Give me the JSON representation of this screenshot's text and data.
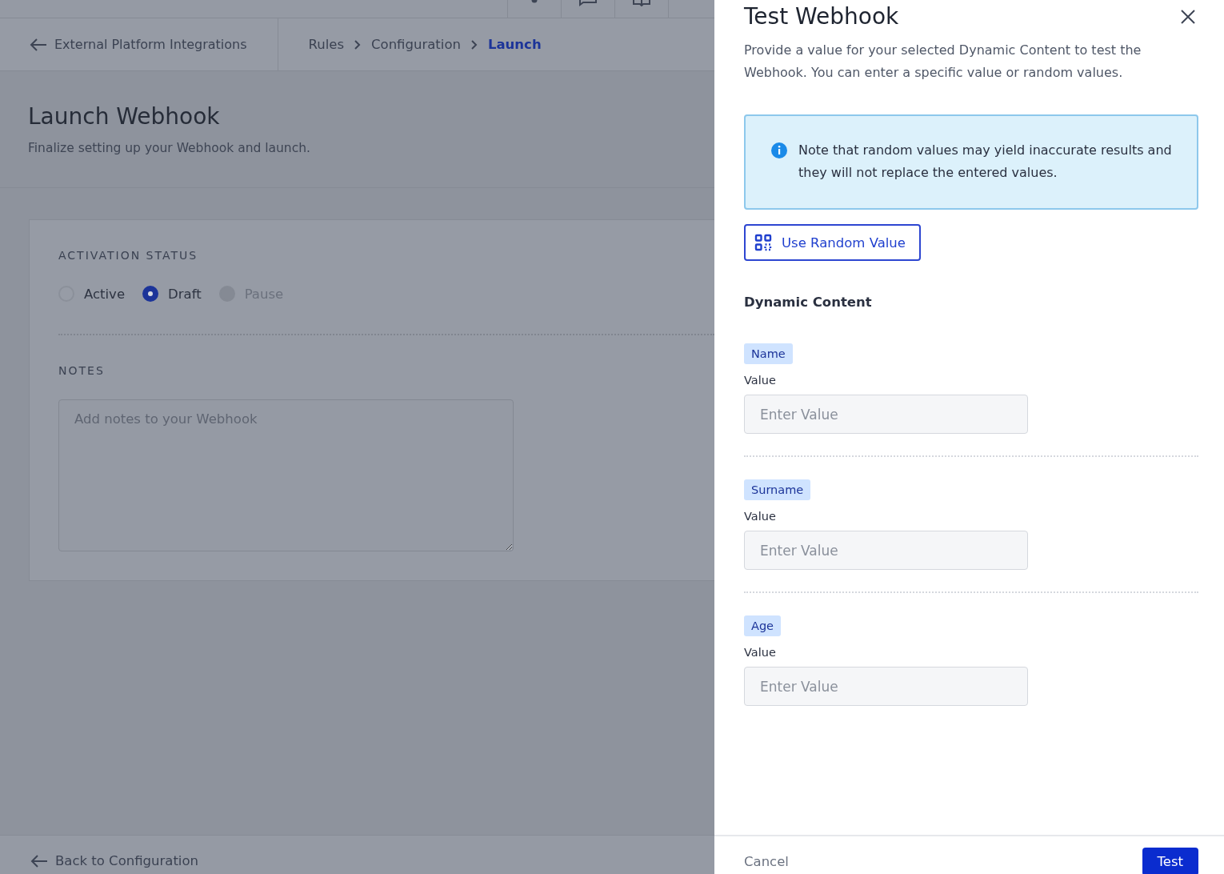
{
  "top_bar": {
    "icons": [
      {
        "kind": "dot"
      },
      {
        "kind": "chat"
      },
      {
        "kind": "book"
      }
    ]
  },
  "breadcrumb_bar": {
    "back_link": "External Platform Integrations",
    "crumbs": [
      {
        "label": "Rules",
        "selected": false
      },
      {
        "label": "Configuration",
        "selected": false
      },
      {
        "label": "Launch",
        "selected": true
      }
    ]
  },
  "page": {
    "title": "Launch Webhook",
    "subtitle": "Finalize setting up your Webhook and launch."
  },
  "activation_status": {
    "heading": "ACTIVATION STATUS",
    "options": [
      {
        "label": "Active",
        "selected": false,
        "disabled": false
      },
      {
        "label": "Draft",
        "selected": true,
        "disabled": false
      },
      {
        "label": "Pause",
        "selected": false,
        "disabled": true
      }
    ]
  },
  "notes": {
    "heading": "NOTES",
    "placeholder": "Add notes to your Webhook"
  },
  "footer": {
    "back_link": "Back to Configuration"
  },
  "drawer": {
    "title": "Test Webhook",
    "description": "Provide a value for your selected Dynamic Content to test the Webhook. You can enter a specific value or random values.",
    "notice": "Note that random values may yield inaccurate results and they will not replace the entered values.",
    "random_button": "Use Random Value",
    "section_title": "Dynamic Content",
    "fields": [
      {
        "tag": "Name",
        "label": "Value",
        "placeholder": "Enter Value"
      },
      {
        "tag": "Surname",
        "label": "Value",
        "placeholder": "Enter Value"
      },
      {
        "tag": "Age",
        "label": "Value",
        "placeholder": "Enter Value"
      }
    ],
    "cancel": "Cancel",
    "submit": "Test"
  }
}
